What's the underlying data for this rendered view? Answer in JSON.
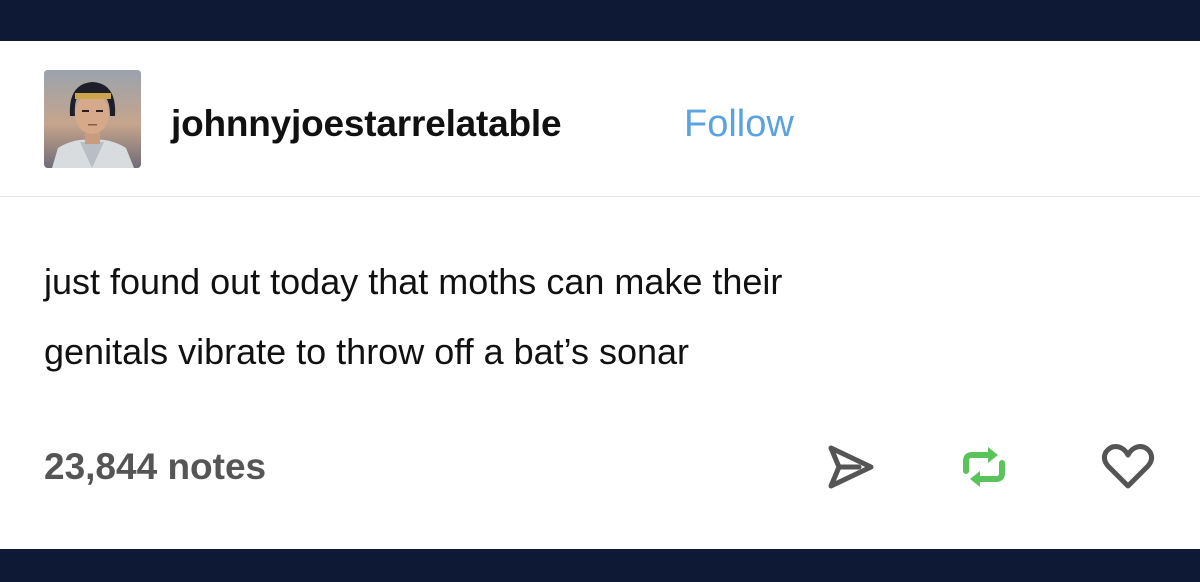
{
  "post": {
    "username": "johnnyjoestarrelatable",
    "follow_label": "Follow",
    "text_lines": [
      "just found out today that moths can make their",
      "genitals vibrate to throw off a bat’s sonar"
    ],
    "notes": "23,844 notes"
  },
  "actions": {
    "share_icon": "share-icon",
    "reblog_icon": "reblog-icon",
    "like_icon": "heart-icon"
  },
  "colors": {
    "frame": "#0e1a35",
    "follow": "#5ba3e0",
    "reblog": "#5ac35a",
    "text": "#111111",
    "notes": "#555555",
    "icon": "#555555"
  }
}
